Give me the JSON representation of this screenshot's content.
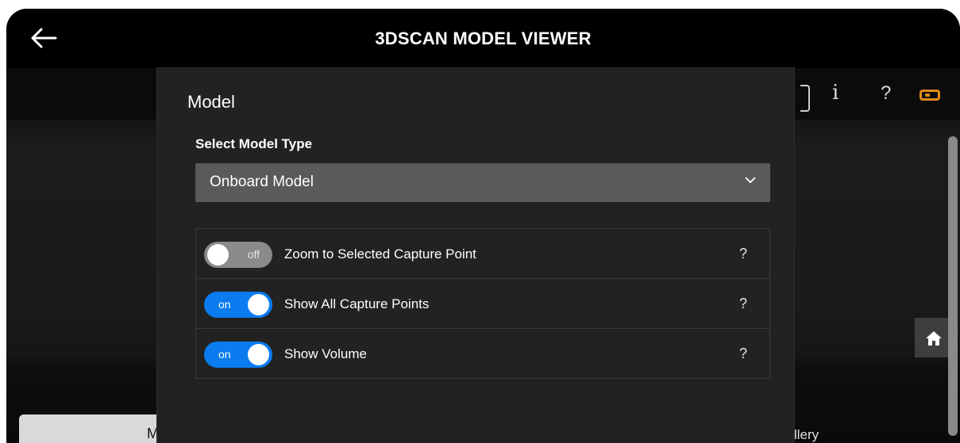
{
  "header": {
    "title": "3DSCAN MODEL VIEWER",
    "back_icon": "arrow-left-icon"
  },
  "toolbar": {
    "info_glyph": "i",
    "help_glyph": "?",
    "battery_color": "#e38a1a"
  },
  "panel": {
    "title": "Model",
    "select_label": "Select Model Type",
    "select_value": "Onboard Model",
    "options": [
      {
        "state": "off",
        "label": "Zoom to Selected Capture Point",
        "help": "?"
      },
      {
        "state": "on",
        "label": "Show All Capture Points",
        "help": "?"
      },
      {
        "state": "on",
        "label": "Show Volume",
        "help": "?"
      }
    ]
  },
  "background": {
    "left_button_text": "M",
    "right_text": "llery"
  },
  "colors": {
    "toggle_on": "#0a7cf0",
    "toggle_off": "#8a8a8a",
    "panel_bg": "#222222"
  }
}
